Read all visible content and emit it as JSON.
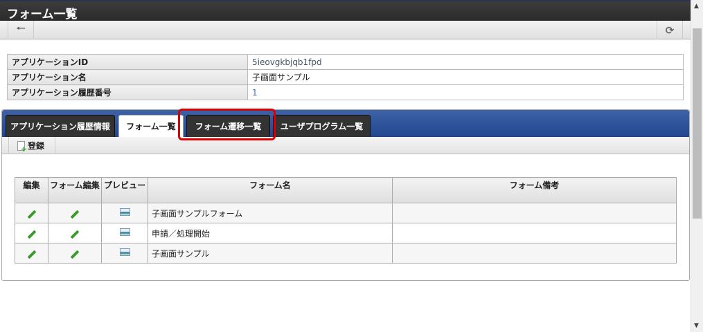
{
  "window": {
    "title": "フォーム一覧"
  },
  "toolbar": {
    "back_icon": "arrow-left",
    "refresh_icon": "refresh"
  },
  "info": {
    "rows": [
      {
        "label": "アプリケーションID",
        "value": "5ieovgkbjqb1fpd"
      },
      {
        "label": "アプリケーション名",
        "value": "子画面サンプル"
      },
      {
        "label": "アプリケーション履歴番号",
        "value": "1"
      }
    ]
  },
  "tabs": [
    {
      "label": "アプリケーション履歴情報"
    },
    {
      "label": "フォーム一覧",
      "active": true
    },
    {
      "label": "フォーム遷移一覧",
      "highlighted": true
    },
    {
      "label": "ユーザプログラム一覧"
    }
  ],
  "actions": {
    "register_label": "登録"
  },
  "grid": {
    "headers": [
      "編集",
      "フォーム編集",
      "プレビュー",
      "フォーム名",
      "フォーム備考"
    ],
    "rows": [
      {
        "name": "子画面サンプルフォーム",
        "note": ""
      },
      {
        "name": "申請／処理開始",
        "note": ""
      },
      {
        "name": "子画面サンプル",
        "note": ""
      }
    ]
  },
  "colors": {
    "highlight": "#dd0000",
    "tabbar": "#2f5499"
  }
}
